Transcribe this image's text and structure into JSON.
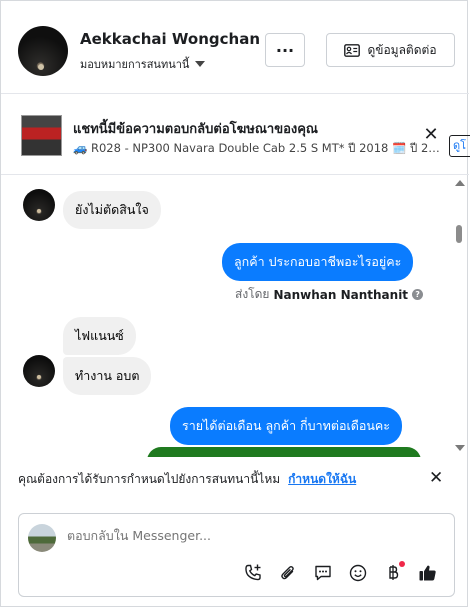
{
  "header": {
    "contact_name": "Aekkachai Wongchan",
    "assign_label": "มอบหมายการสนทนานี้",
    "more_label": "···",
    "contact_info_label": "ดูข้อมูลติดต่อ"
  },
  "ad_banner": {
    "title": "แชทนี้มีข้อความตอบกลับต่อโฆษณาของคุณ",
    "subtitle": "🚙 R028 - NP300 Navara Double Cab 2.5 S MT* ปี 2018 🗓️ ปี 201...",
    "link_label": "ดูโ"
  },
  "messages": [
    {
      "direction": "in",
      "text": "ยังไม่ตัดสินใจ"
    },
    {
      "direction": "out",
      "text": "ลูกค้า ประกอบอาชีพอะไรอยู่คะ"
    },
    {
      "direction": "in",
      "text": "ไฟแนนซ์"
    },
    {
      "direction": "in",
      "text": "ทำงาน อบต"
    },
    {
      "direction": "out",
      "text": "รายได้ต่อเดือน ลูกค้า   กี่บาทต่อเดือนคะ"
    }
  ],
  "sent_by": {
    "prefix": "ส่งโดย",
    "name": "Nanwhan Nanthanit"
  },
  "reminder": {
    "text": "คุณต้องการได้รับการกำหนดไปยังการสนทนานี้ไหม",
    "link": "กำหนดให้ฉัน"
  },
  "composer": {
    "placeholder": "ตอบกลับใน Messenger..."
  },
  "colors": {
    "accent": "#0a7cff",
    "link": "#1877f2",
    "incoming_bubble": "#f0f0f0",
    "notification_dot": "#f02849"
  }
}
